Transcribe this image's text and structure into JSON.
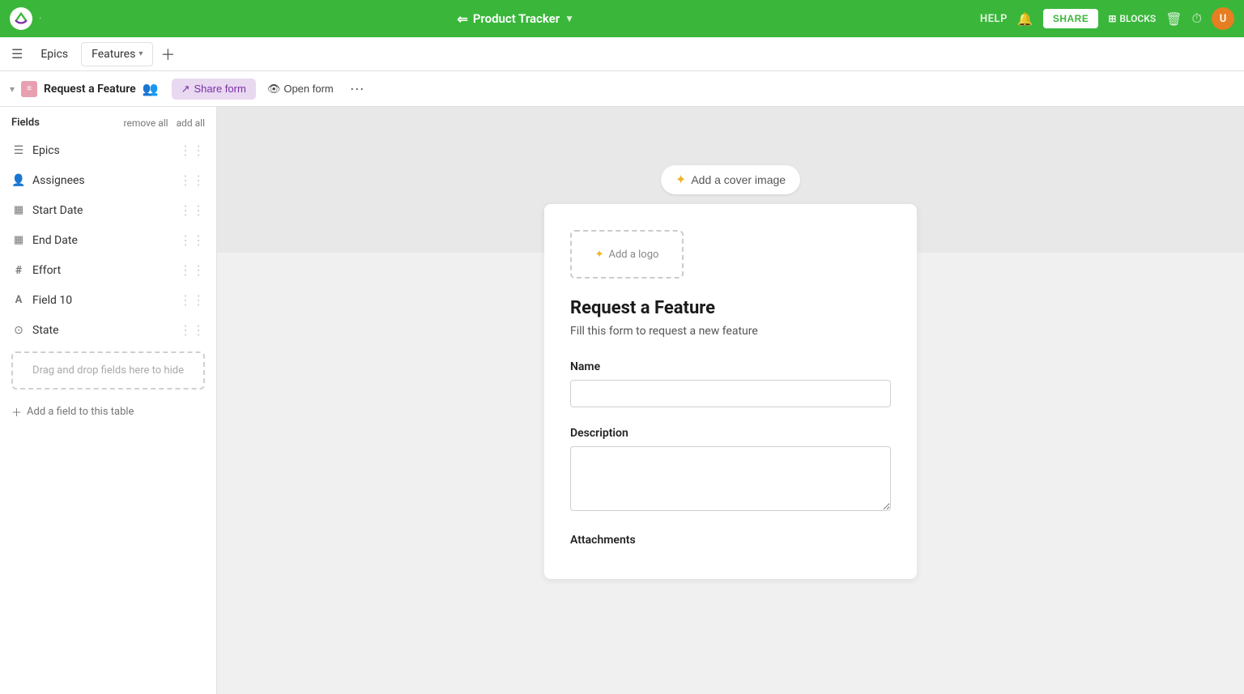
{
  "app": {
    "logo_label": "ClickUp",
    "title": "Product Tracker",
    "title_arrow": "▼"
  },
  "topnav": {
    "help_label": "HELP",
    "share_label": "SHARE",
    "blocks_label": "BLOCKS",
    "avatar_initial": "U"
  },
  "second_nav": {
    "epics_tab": "Epics",
    "features_tab": "Features",
    "features_arrow": "▾"
  },
  "breadcrumb": {
    "title": "Request a Feature",
    "share_form_label": "Share form",
    "open_form_label": "Open form",
    "more_label": "···"
  },
  "sidebar": {
    "title": "Fields",
    "remove_all": "remove all",
    "add_all": "add all",
    "fields": [
      {
        "icon": "≡",
        "label": "Epics",
        "type": "list"
      },
      {
        "icon": "👤",
        "label": "Assignees",
        "type": "people"
      },
      {
        "icon": "📅",
        "label": "Start Date",
        "type": "date"
      },
      {
        "icon": "📅",
        "label": "End Date",
        "type": "date"
      },
      {
        "icon": "#",
        "label": "Effort",
        "type": "number"
      },
      {
        "icon": "A",
        "label": "Field 10",
        "type": "text"
      },
      {
        "icon": "⊙",
        "label": "State",
        "type": "status"
      }
    ],
    "drop_zone_label": "Drag and drop fields here to hide",
    "add_field_label": "Add a field to this table"
  },
  "form": {
    "add_cover_label": "Add a cover image",
    "add_logo_label": "Add a logo",
    "title": "Request a Feature",
    "description": "Fill this form to request a new feature",
    "name_label": "Name",
    "name_placeholder": "",
    "description_label": "Description",
    "description_placeholder": "",
    "attachments_label": "Attachments"
  },
  "colors": {
    "green": "#3ab73a",
    "purple_light": "#e8d8f0",
    "purple": "#7b2fa8",
    "pink": "#e8a0b0",
    "star": "#f0b429"
  }
}
